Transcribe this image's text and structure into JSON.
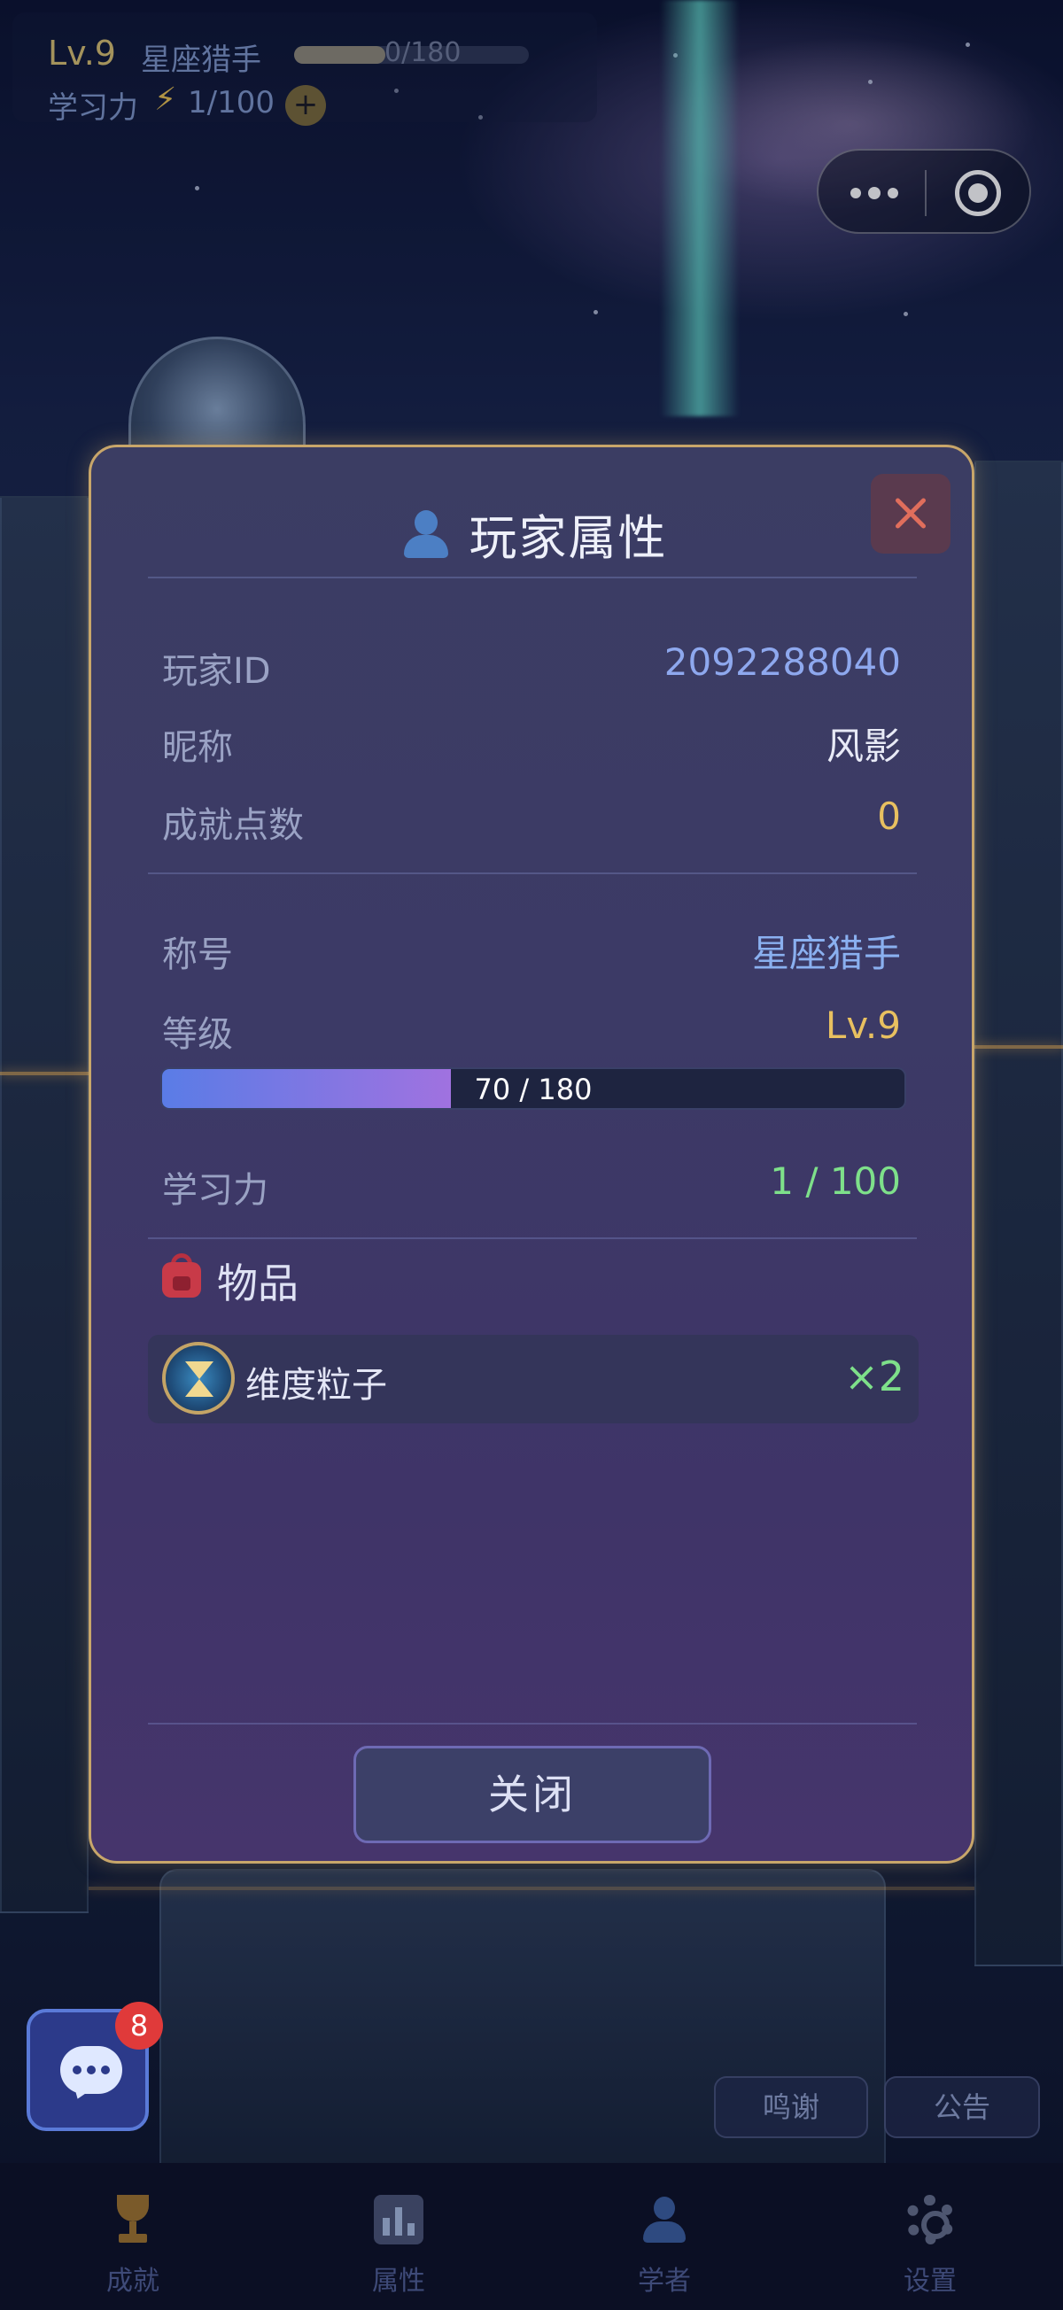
{
  "hud": {
    "level": "Lv.9",
    "title": "星座猎手",
    "exp_text": "0/180",
    "exp_fraction": 0.39,
    "power_label": "学习力",
    "power_icon": "lightning-icon",
    "power_value": "1/100",
    "plus_label": "+"
  },
  "capsule": {
    "more_icon": "more-dots-icon",
    "close_icon": "target-circle-icon"
  },
  "modal": {
    "title": "玩家属性",
    "title_icon": "person-icon",
    "close_icon": "close-x-icon",
    "rows": {
      "player_id": {
        "label": "玩家ID",
        "value": "2092288040"
      },
      "nickname": {
        "label": "昵称",
        "value": "风影"
      },
      "achievement_points": {
        "label": "成就点数",
        "value": "0"
      },
      "rank_title": {
        "label": "称号",
        "value": "星座猎手"
      },
      "level": {
        "label": "等级",
        "value": "Lv.9"
      },
      "learning_power": {
        "label": "学习力",
        "value": "1 / 100"
      }
    },
    "level_progress": {
      "text": "70 / 180",
      "fraction": 0.3889
    },
    "items_section": {
      "title": "物品",
      "icon": "backpack-icon"
    },
    "items": [
      {
        "name": "维度粒子",
        "count": "×2",
        "icon": "hourglass-icon"
      }
    ],
    "close_button": "关闭"
  },
  "chat": {
    "badge": "8",
    "icon": "chat-bubble-icon"
  },
  "pills": {
    "thanks": "鸣谢",
    "notice": "公告"
  },
  "tabs": [
    {
      "label": "成就",
      "icon": "trophy-icon"
    },
    {
      "label": "属性",
      "icon": "bar-chart-icon"
    },
    {
      "label": "学者",
      "icon": "user-icon"
    },
    {
      "label": "设置",
      "icon": "gear-icon"
    }
  ],
  "colors": {
    "modal_border": "#c8a66a",
    "id_value": "#8ea8ee",
    "title_value": "#8ab0f0",
    "level_value": "#e8c060",
    "points_value": "#e8c060",
    "power_value": "#7ee08a",
    "close_x": "#e06e5c"
  }
}
